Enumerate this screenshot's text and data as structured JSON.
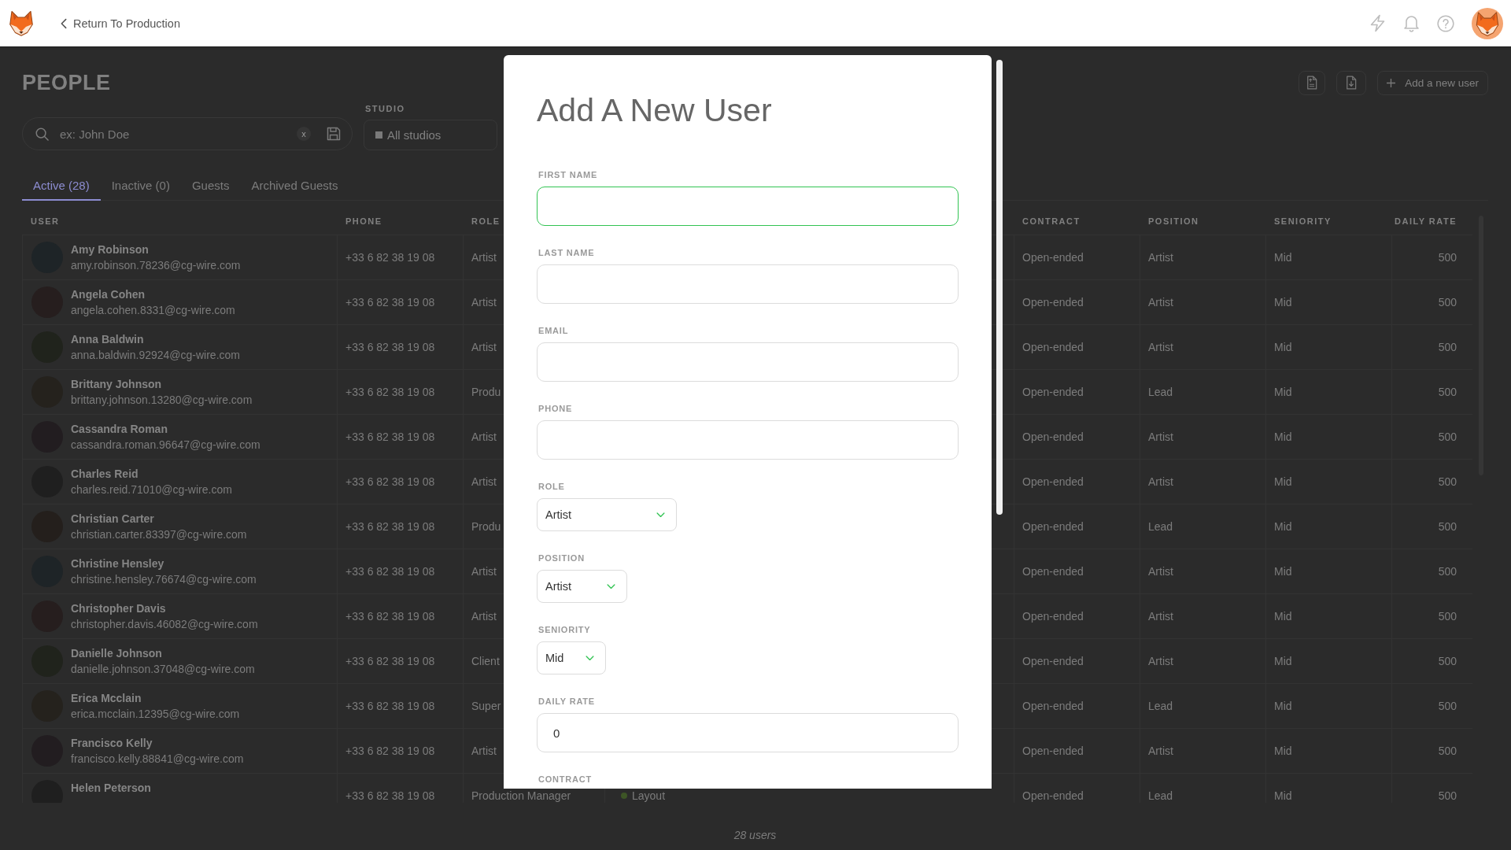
{
  "top_bar": {
    "back_link": "Return To Production"
  },
  "page": {
    "title": "PEOPLE",
    "actions": [
      {
        "kind": "import"
      },
      {
        "kind": "export"
      },
      {
        "kind": "add",
        "label": "Add a new user"
      }
    ],
    "search": {
      "placeholder": "ex: John Doe",
      "clear": "x"
    },
    "studio_filter": {
      "label": "STUDIO",
      "value": "All studios"
    },
    "tabs": [
      {
        "label": "Active (28)",
        "selected": true
      },
      {
        "label": "Inactive (0)",
        "selected": false
      },
      {
        "label": "Guests",
        "selected": false
      },
      {
        "label": "Archived Guests",
        "selected": false
      }
    ],
    "table": {
      "columns": [
        "USER",
        "PHONE",
        "ROLE",
        "CONTRACT",
        "POSITION",
        "SENIORITY",
        "DAILY RATE"
      ],
      "rows": [
        {
          "name": "Amy Robinson",
          "email": "amy.robinson.78236@cg-wire.com",
          "phone": "+33 6 82 38 19 08",
          "role": "Artist",
          "contract": "Open-ended",
          "position": "Artist",
          "seniority": "Mid",
          "daily_rate": "500"
        },
        {
          "name": "Angela Cohen",
          "email": "angela.cohen.8331@cg-wire.com",
          "phone": "+33 6 82 38 19 08",
          "role": "Artist",
          "contract": "Open-ended",
          "position": "Artist",
          "seniority": "Mid",
          "daily_rate": "500"
        },
        {
          "name": "Anna Baldwin",
          "email": "anna.baldwin.92924@cg-wire.com",
          "phone": "+33 6 82 38 19 08",
          "role": "Artist",
          "contract": "Open-ended",
          "position": "Artist",
          "seniority": "Mid",
          "daily_rate": "500"
        },
        {
          "name": "Brittany Johnson",
          "email": "brittany.johnson.13280@cg-wire.com",
          "phone": "+33 6 82 38 19 08",
          "role": "Produ",
          "contract": "Open-ended",
          "position": "Lead",
          "seniority": "Mid",
          "daily_rate": "500"
        },
        {
          "name": "Cassandra Roman",
          "email": "cassandra.roman.96647@cg-wire.com",
          "phone": "+33 6 82 38 19 08",
          "role": "Artist",
          "contract": "Open-ended",
          "position": "Artist",
          "seniority": "Mid",
          "daily_rate": "500"
        },
        {
          "name": "Charles Reid",
          "email": "charles.reid.71010@cg-wire.com",
          "phone": "+33 6 82 38 19 08",
          "role": "Artist",
          "contract": "Open-ended",
          "position": "Artist",
          "seniority": "Mid",
          "daily_rate": "500"
        },
        {
          "name": "Christian Carter",
          "email": "christian.carter.83397@cg-wire.com",
          "phone": "+33 6 82 38 19 08",
          "role": "Produ",
          "contract": "Open-ended",
          "position": "Lead",
          "seniority": "Mid",
          "daily_rate": "500"
        },
        {
          "name": "Christine Hensley",
          "email": "christine.hensley.76674@cg-wire.com",
          "phone": "+33 6 82 38 19 08",
          "role": "Artist",
          "contract": "Open-ended",
          "position": "Artist",
          "seniority": "Mid",
          "daily_rate": "500"
        },
        {
          "name": "Christopher Davis",
          "email": "christopher.davis.46082@cg-wire.com",
          "phone": "+33 6 82 38 19 08",
          "role": "Artist",
          "contract": "Open-ended",
          "position": "Artist",
          "seniority": "Mid",
          "daily_rate": "500"
        },
        {
          "name": "Danielle Johnson",
          "email": "danielle.johnson.37048@cg-wire.com",
          "phone": "+33 6 82 38 19 08",
          "role": "Client",
          "contract": "Open-ended",
          "position": "Artist",
          "seniority": "Mid",
          "daily_rate": "500"
        },
        {
          "name": "Erica Mcclain",
          "email": "erica.mcclain.12395@cg-wire.com",
          "phone": "+33 6 82 38 19 08",
          "role": "Super",
          "contract": "Open-ended",
          "position": "Lead",
          "seniority": "Mid",
          "daily_rate": "500"
        },
        {
          "name": "Francisco Kelly",
          "email": "francisco.kelly.88841@cg-wire.com",
          "phone": "+33 6 82 38 19 08",
          "role": "Artist",
          "contract": "Open-ended",
          "position": "Artist",
          "seniority": "Mid",
          "daily_rate": "500"
        },
        {
          "name": "Helen Peterson",
          "phone": "+33 6 82 38 19 08",
          "role": "Production Manager",
          "department": {
            "label": "Layout",
            "color": "#3d5526"
          },
          "contract": "Open-ended",
          "position": "Lead",
          "seniority": "Mid",
          "daily_rate": "500"
        }
      ]
    },
    "footer": "28 users"
  },
  "dialog": {
    "title": "Add A New User",
    "fields": [
      {
        "kind": "text",
        "label": "FIRST NAME",
        "focused": true
      },
      {
        "kind": "text",
        "label": "LAST NAME",
        "focused": false
      },
      {
        "kind": "text",
        "label": "EMAIL",
        "focused": false
      },
      {
        "kind": "text",
        "label": "PHONE",
        "focused": false
      },
      {
        "kind": "select",
        "label": "ROLE",
        "value": "Artist"
      },
      {
        "kind": "select",
        "label": "POSITION",
        "value": "Artist"
      },
      {
        "kind": "select",
        "label": "SENIORITY",
        "value": "Mid"
      },
      {
        "kind": "text",
        "label": "DAILY RATE",
        "value": "0",
        "focused": false
      },
      {
        "kind": "label",
        "label": "CONTRACT"
      }
    ]
  }
}
